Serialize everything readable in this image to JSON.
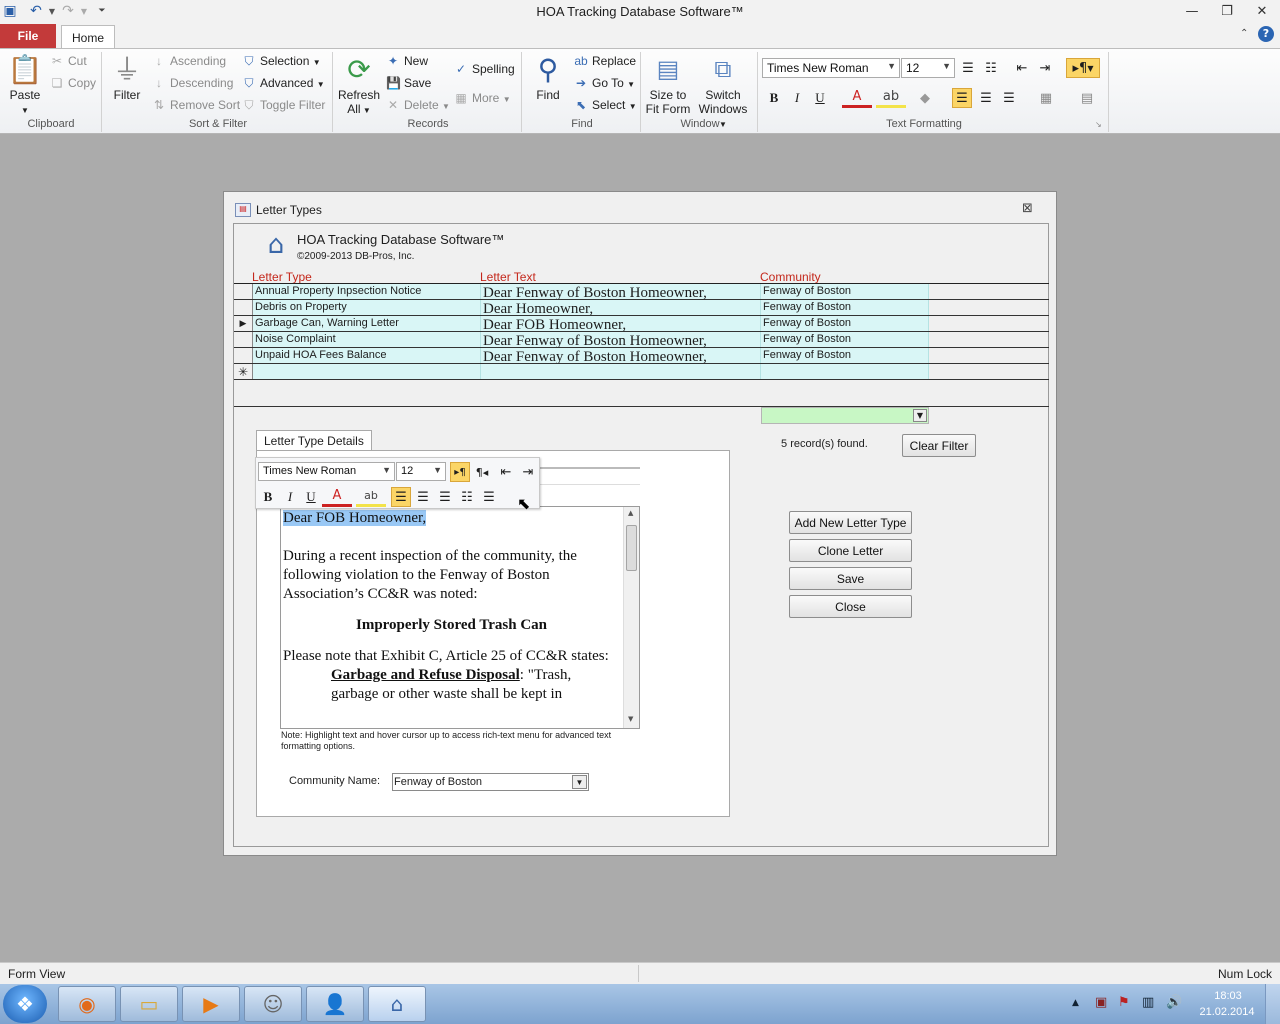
{
  "app": {
    "title": "HOA Tracking Database Software™"
  },
  "ribbon": {
    "file_tab": "File",
    "home_tab": "Home",
    "clipboard": {
      "paste": "Paste",
      "cut": "Cut",
      "copy": "Copy",
      "group": "Clipboard"
    },
    "sort_filter": {
      "filter": "Filter",
      "ascending": "Ascending",
      "descending": "Descending",
      "remove_sort": "Remove Sort",
      "selection": "Selection",
      "advanced": "Advanced",
      "toggle_filter": "Toggle Filter",
      "group": "Sort & Filter"
    },
    "records": {
      "refresh": "Refresh",
      "refresh_all": "All",
      "new": "New",
      "save": "Save",
      "delete": "Delete",
      "spelling": "Spelling",
      "more": "More",
      "group": "Records"
    },
    "find": {
      "find": "Find",
      "replace": "Replace",
      "go_to": "Go To",
      "select": "Select",
      "group": "Find"
    },
    "window": {
      "size_to_fit": "Size to",
      "size_to_fit2": "Fit Form",
      "switch": "Switch",
      "switch2": "Windows",
      "group": "Window"
    },
    "text_formatting": {
      "font": "Times New Roman",
      "size": "12",
      "group": "Text Formatting"
    }
  },
  "form": {
    "window_title": "Letter Types",
    "header_title": "HOA Tracking Database Software™",
    "header_copyright": "©2009-2013 DB-Pros, Inc.",
    "columns": {
      "letter_type": "Letter Type",
      "letter_text": "Letter Text",
      "community": "Community"
    },
    "rows": [
      {
        "type": "Annual Property Inpsection Notice",
        "text": "Dear Fenway of Boston Homeowner,",
        "community": "Fenway of Boston"
      },
      {
        "type": "Debris on Property",
        "text": "Dear Homeowner,",
        "community": "Fenway of Boston"
      },
      {
        "type": "Garbage Can, Warning Letter",
        "text": "Dear FOB Homeowner,",
        "community": "Fenway of Boston"
      },
      {
        "type": "Noise Complaint",
        "text": "Dear Fenway of Boston Homeowner,",
        "community": "Fenway of Boston"
      },
      {
        "type": "Unpaid HOA Fees Balance",
        "text": "Dear Fenway of Boston Homeowner,",
        "community": "Fenway of Boston"
      }
    ],
    "records_found_count": "5",
    "records_found_label": "record(s) found.",
    "clear_filter": "Clear Filter",
    "details_tab": "Letter Type Details",
    "mini_toolbar": {
      "font": "Times New Roman",
      "size": "12"
    },
    "letter": {
      "salutation": "Dear FOB Homeowner,",
      "para1": "During a recent inspection of the community, the following violation to the Fenway of Boston Association’s CC&R was noted:",
      "heading": "Improperly Stored Trash Can",
      "para2": "Please note that Exhibit C, Article 25 of CC&R states:",
      "quote_title": "Garbage and Refuse Disposal",
      "quote_text": ": \"Trash, garbage or other waste shall be kept in"
    },
    "note": "Note: Highlight text and hover cursor up to access rich-text menu for advanced text formatting options.",
    "community_label": "Community Name:",
    "community_value": "Fenway of Boston",
    "buttons": {
      "add_new": "Add New Letter Type",
      "clone": "Clone Letter",
      "save": "Save",
      "close": "Close"
    }
  },
  "status": {
    "left": "Form View",
    "right": "Num Lock"
  },
  "taskbar": {
    "time": "18:03",
    "date": "21.02.2014"
  }
}
